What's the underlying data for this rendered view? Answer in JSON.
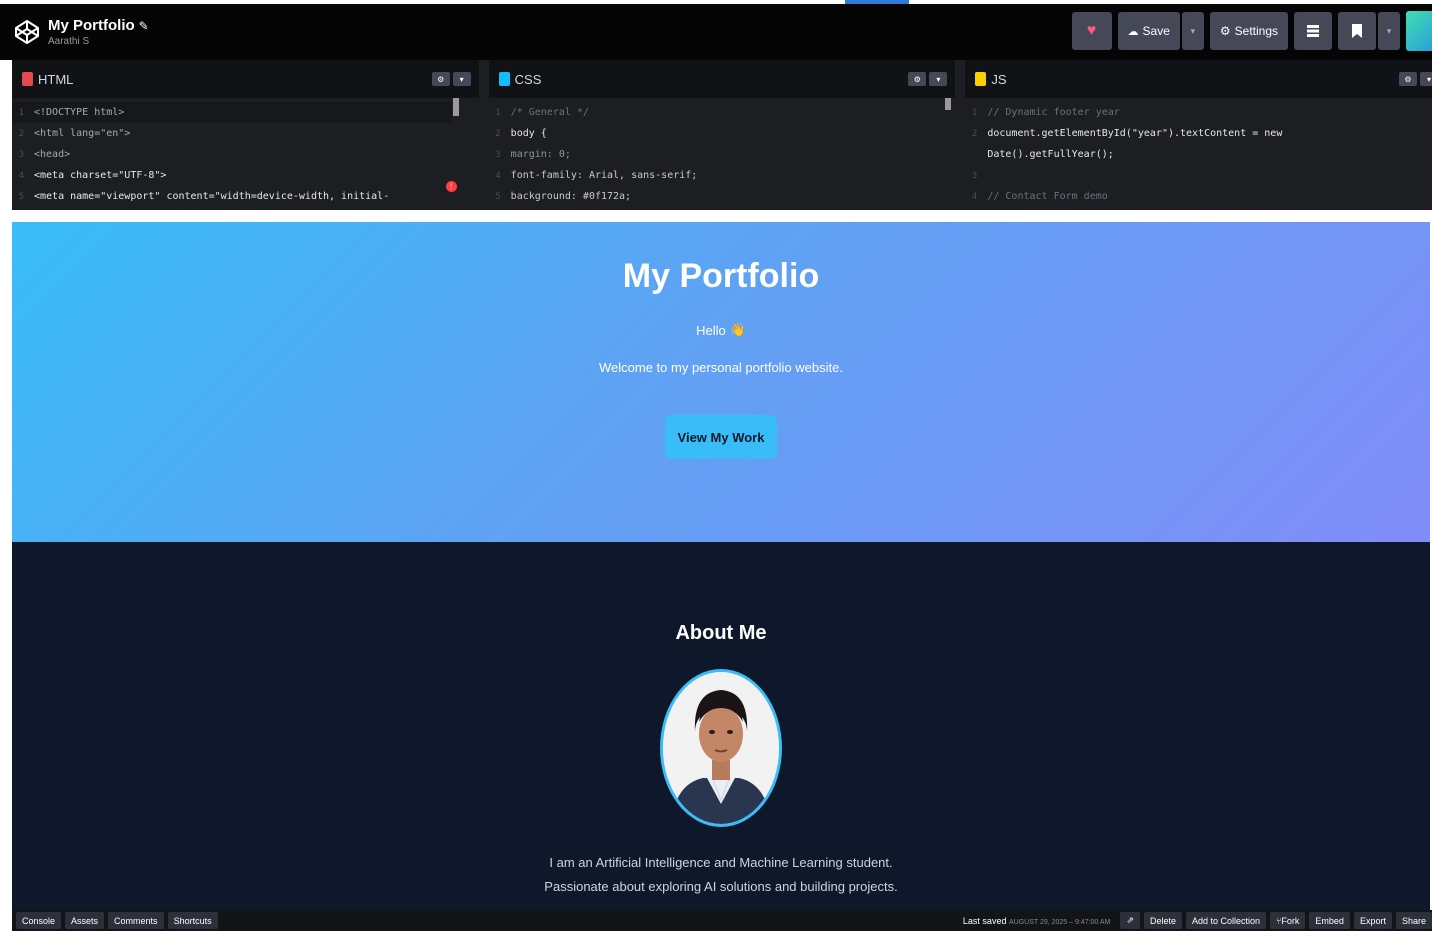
{
  "header": {
    "title": "My Portfolio",
    "author": "Aarathi S",
    "actions": {
      "save_label": "Save",
      "settings_label": "Settings"
    }
  },
  "editors": [
    {
      "lang": "HTML",
      "badge_color": "#e5484d",
      "lines": [
        "<!DOCTYPE html>",
        "<html lang=\"en\">",
        "<head>",
        "  <meta charset=\"UTF-8\">",
        "  <meta name=\"viewport\" content=\"width=device-width, initial-"
      ]
    },
    {
      "lang": "CSS",
      "badge_color": "#0ebeff",
      "lines": [
        "/* General */",
        "body {",
        "  margin: 0;",
        "  font-family: Arial, sans-serif;",
        "  background: #0f172a;"
      ]
    },
    {
      "lang": "JS",
      "badge_color": "#fcd000",
      "lines": [
        "// Dynamic footer year",
        "document.getElementById(\"year\").textContent = new",
        "Date().getFullYear();",
        "",
        "// Contact Form demo"
      ]
    }
  ],
  "preview": {
    "hero": {
      "title": "My Portfolio",
      "hello": "Hello",
      "hello_emoji": "👋",
      "welcome": "Welcome to my personal portfolio website.",
      "button": "View My Work"
    },
    "about": {
      "title": "About Me",
      "line1": "I am an Artificial Intelligence and Machine Learning student.",
      "line2": "Passionate about exploring AI solutions and building projects."
    }
  },
  "footer": {
    "left": [
      "Console",
      "Assets",
      "Comments",
      "Shortcuts"
    ],
    "saved_label": "Last saved",
    "saved_time": "AUGUST 29, 2025 – 9:47:00 AM",
    "right": [
      "Delete",
      "Add to Collection",
      "Fork",
      "Embed",
      "Export",
      "Share"
    ]
  },
  "colors": {
    "accent": "#38bdf8",
    "hero_gradient_end": "#818cf8",
    "page_bg": "#0f172a"
  }
}
